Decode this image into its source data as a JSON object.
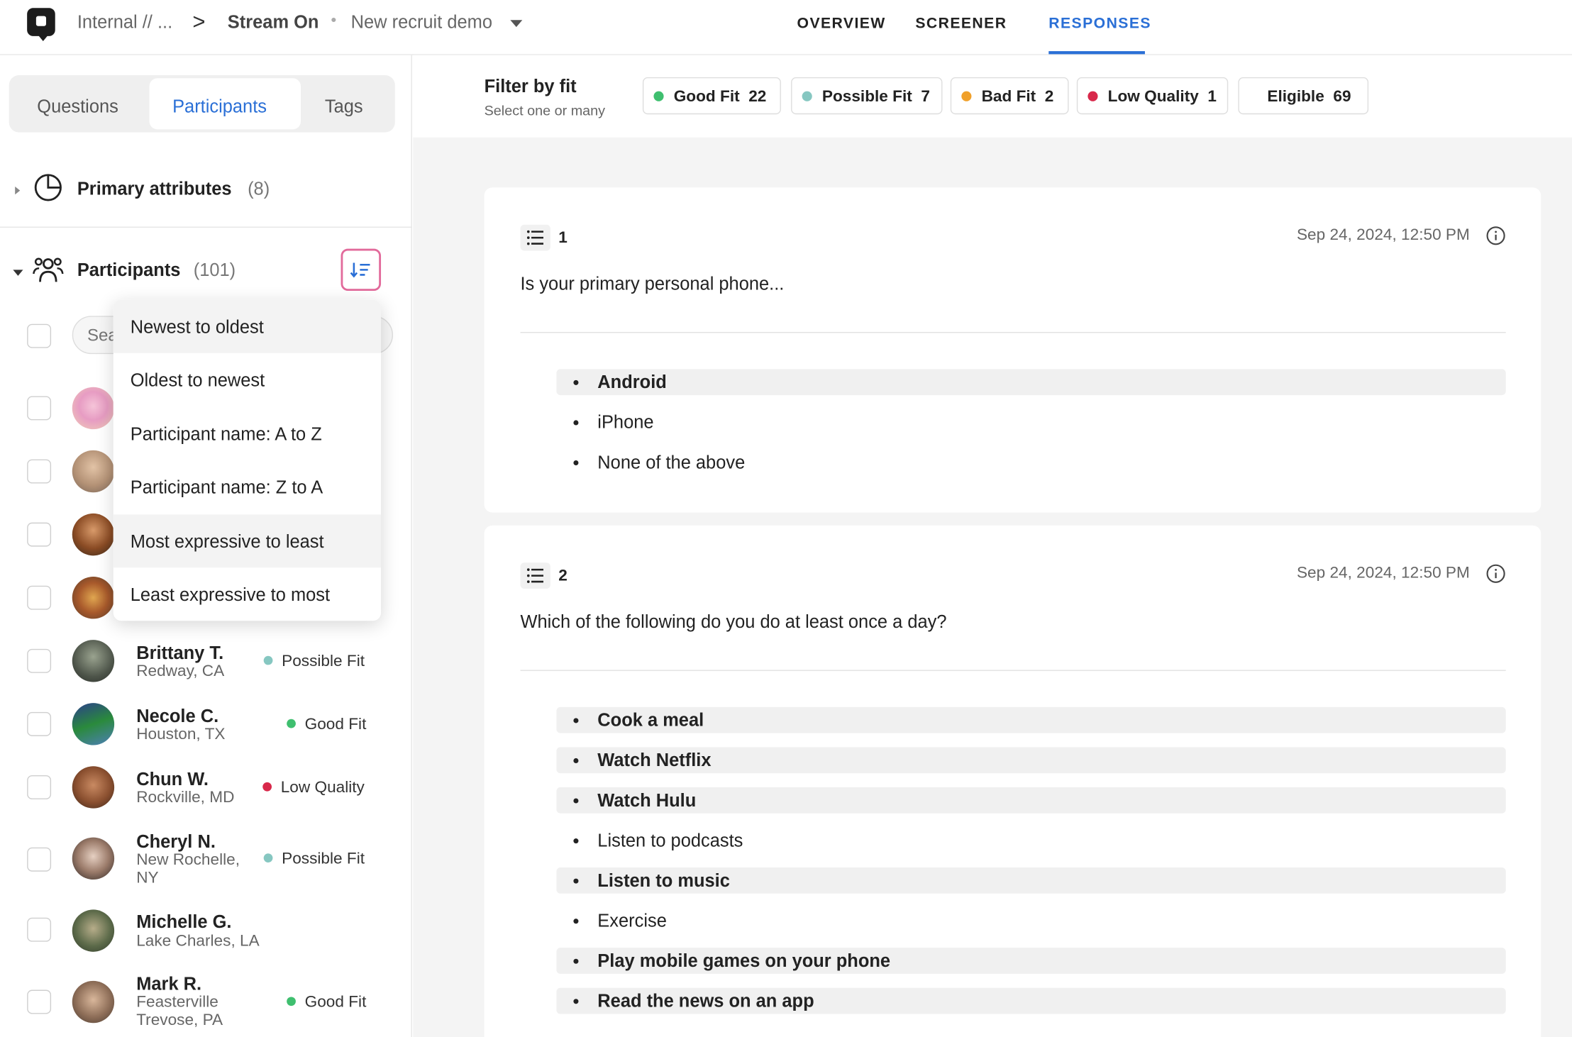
{
  "topbar": {
    "breadcrumb_workspace": "Internal // ...",
    "breadcrumb_sep": ">",
    "breadcrumb_project": "Stream On",
    "breadcrumb_dot": "•",
    "breadcrumb_study": "New recruit demo",
    "tabs": [
      {
        "label": "OVERVIEW"
      },
      {
        "label": "SCREENER"
      },
      {
        "label": "RESPONSES"
      }
    ]
  },
  "sidebar": {
    "segments": [
      {
        "label": "Questions"
      },
      {
        "label": "Participants"
      },
      {
        "label": "Tags"
      }
    ],
    "primary_attributes": {
      "title": "Primary attributes",
      "count": "(8)"
    },
    "participants_section": {
      "title": "Participants",
      "count": "(101)"
    },
    "search": {
      "placeholder": "Search"
    },
    "sort_menu": [
      {
        "label": "Newest to oldest"
      },
      {
        "label": "Oldest to newest"
      },
      {
        "label": "Participant name: A to Z"
      },
      {
        "label": "Participant name: Z to A"
      },
      {
        "label": "Most expressive to least"
      },
      {
        "label": "Least expressive to most"
      }
    ],
    "participants": [
      {
        "name": "Brittany T.",
        "location": "Redway, CA",
        "fit": "Possible Fit"
      },
      {
        "name": "Necole C.",
        "location": "Houston, TX",
        "fit": "Good Fit"
      },
      {
        "name": "Chun W.",
        "location": "Rockville, MD",
        "fit": "Low Quality"
      },
      {
        "name": "Cheryl N.",
        "location": "New Rochelle, NY",
        "fit": "Possible Fit"
      },
      {
        "name": "Michelle G.",
        "location": "Lake Charles, LA",
        "fit": ""
      },
      {
        "name": "Mark R.",
        "location": "Feasterville Trevose, PA",
        "fit": "Good Fit"
      }
    ]
  },
  "filter": {
    "title": "Filter by fit",
    "subtitle": "Select one or many",
    "chips": [
      {
        "label": "Good Fit",
        "count": "22"
      },
      {
        "label": "Possible Fit",
        "count": "7"
      },
      {
        "label": "Bad Fit",
        "count": "2"
      },
      {
        "label": "Low Quality",
        "count": "1"
      },
      {
        "label": "Eligible",
        "count": "69"
      }
    ]
  },
  "colors": {
    "accent": "#2a6fd6",
    "good_fit": "#3fbf6f",
    "possible_fit": "#86c7c1",
    "bad_fit": "#f0a02a",
    "low_quality": "#d8284a",
    "sort_button_border": "#e26a9b"
  },
  "questions": [
    {
      "number": "1",
      "date": "Sep 24, 2024, 12:50 PM",
      "text": "Is your primary personal phone...",
      "options": [
        {
          "label": "Android",
          "selected": true
        },
        {
          "label": "iPhone",
          "selected": false
        },
        {
          "label": "None of the above",
          "selected": false
        }
      ]
    },
    {
      "number": "2",
      "date": "Sep 24, 2024, 12:50 PM",
      "text": "Which of the following do you do at least once a day?",
      "options": [
        {
          "label": "Cook a meal",
          "selected": true
        },
        {
          "label": "Watch Netflix",
          "selected": true
        },
        {
          "label": "Watch Hulu",
          "selected": true
        },
        {
          "label": "Listen to podcasts",
          "selected": false
        },
        {
          "label": "Listen to music",
          "selected": true
        },
        {
          "label": "Exercise",
          "selected": false
        },
        {
          "label": "Play mobile games on your phone",
          "selected": true
        },
        {
          "label": "Read the news on an app",
          "selected": true
        }
      ]
    }
  ],
  "icons": [
    "app-logo-icon",
    "chevron-right-icon",
    "caret-down-icon",
    "pie-chart-icon",
    "people-icon",
    "sort-icon",
    "list-icon",
    "info-icon"
  ]
}
